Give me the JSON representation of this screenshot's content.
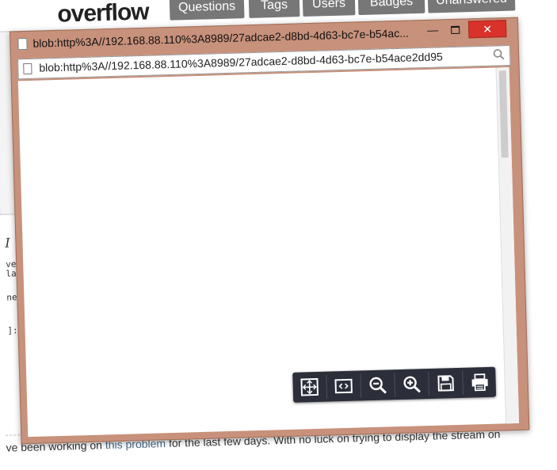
{
  "background_page": {
    "logo_fragment": "overflow",
    "nav": [
      "Questions",
      "Tags",
      "Users",
      "Badges",
      "Unanswered"
    ],
    "editor_fragments": [
      "I",
      "ve",
      "lay",
      "new",
      "]:"
    ],
    "body_text_before": "ve been working on ",
    "body_link": "this problem",
    "body_text_after": " for the last few days. With no luck on trying to display the stream on"
  },
  "popup": {
    "title": "blob:http%3A//192.168.88.110%3A8989/27adcae2-d8bd-4d63-bc7e-b54ac...",
    "address": "blob:http%3A//192.168.88.110%3A8989/27adcae2-d8bd-4d63-bc7e-b54ace2dd95",
    "buttons": {
      "minimize": "—",
      "close": "✕"
    }
  },
  "pdf_toolbar": {
    "tools": [
      "fit-page-icon",
      "rotate-icon",
      "zoom-out-icon",
      "zoom-in-icon",
      "save-icon",
      "print-icon"
    ]
  }
}
